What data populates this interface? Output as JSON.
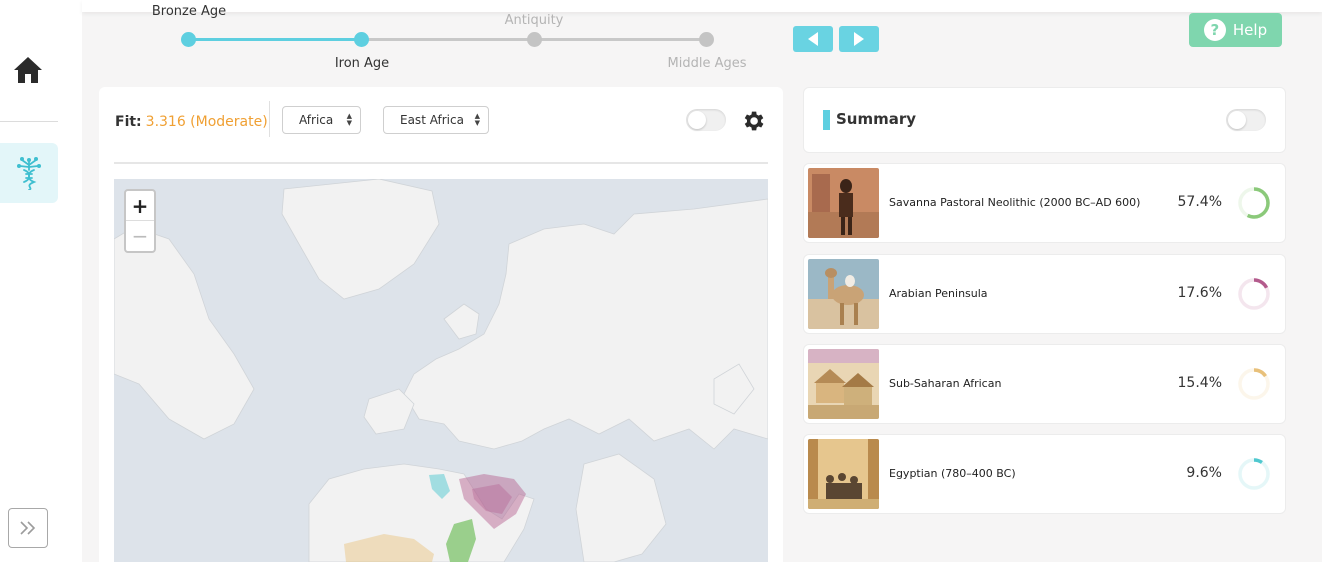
{
  "timeline": {
    "eras": [
      {
        "label": "Bronze Age",
        "state": "done"
      },
      {
        "label": "Iron Age",
        "state": "active"
      },
      {
        "label": "Antiquity",
        "state": "future"
      },
      {
        "label": "Middle Ages",
        "state": "future"
      }
    ]
  },
  "header": {
    "help_label": "Help"
  },
  "map_panel": {
    "fit_label": "Fit:",
    "fit_value": "3.316 (Moderate)",
    "region_select": "Africa",
    "subregion_select": "East Africa",
    "zoom_in": "+",
    "zoom_out": "−"
  },
  "summary": {
    "title": "Summary",
    "populations": [
      {
        "name": "Savanna Pastoral Neolithic (2000 BC–AD 600)",
        "percent": "57.4%",
        "fraction": 0.574,
        "color": "#8bc97a"
      },
      {
        "name": "Arabian Peninsula",
        "percent": "17.6%",
        "fraction": 0.176,
        "color": "#b35a8c"
      },
      {
        "name": "Sub-Saharan African",
        "percent": "15.4%",
        "fraction": 0.154,
        "color": "#e8c07a"
      },
      {
        "name": "Egyptian (780–400 BC)",
        "percent": "9.6%",
        "fraction": 0.096,
        "color": "#4fc8cf"
      }
    ]
  },
  "colors": {
    "accent": "#5ecfe0",
    "help": "#7fd6ae",
    "fit_value": "#f0a033"
  },
  "icons": {
    "home": "home-icon",
    "dna": "dna-tree-icon",
    "expand": "double-chevron-right-icon",
    "prev": "triangle-left-icon",
    "next": "triangle-right-icon",
    "settings": "gear-icon",
    "help": "question-mark-icon"
  }
}
